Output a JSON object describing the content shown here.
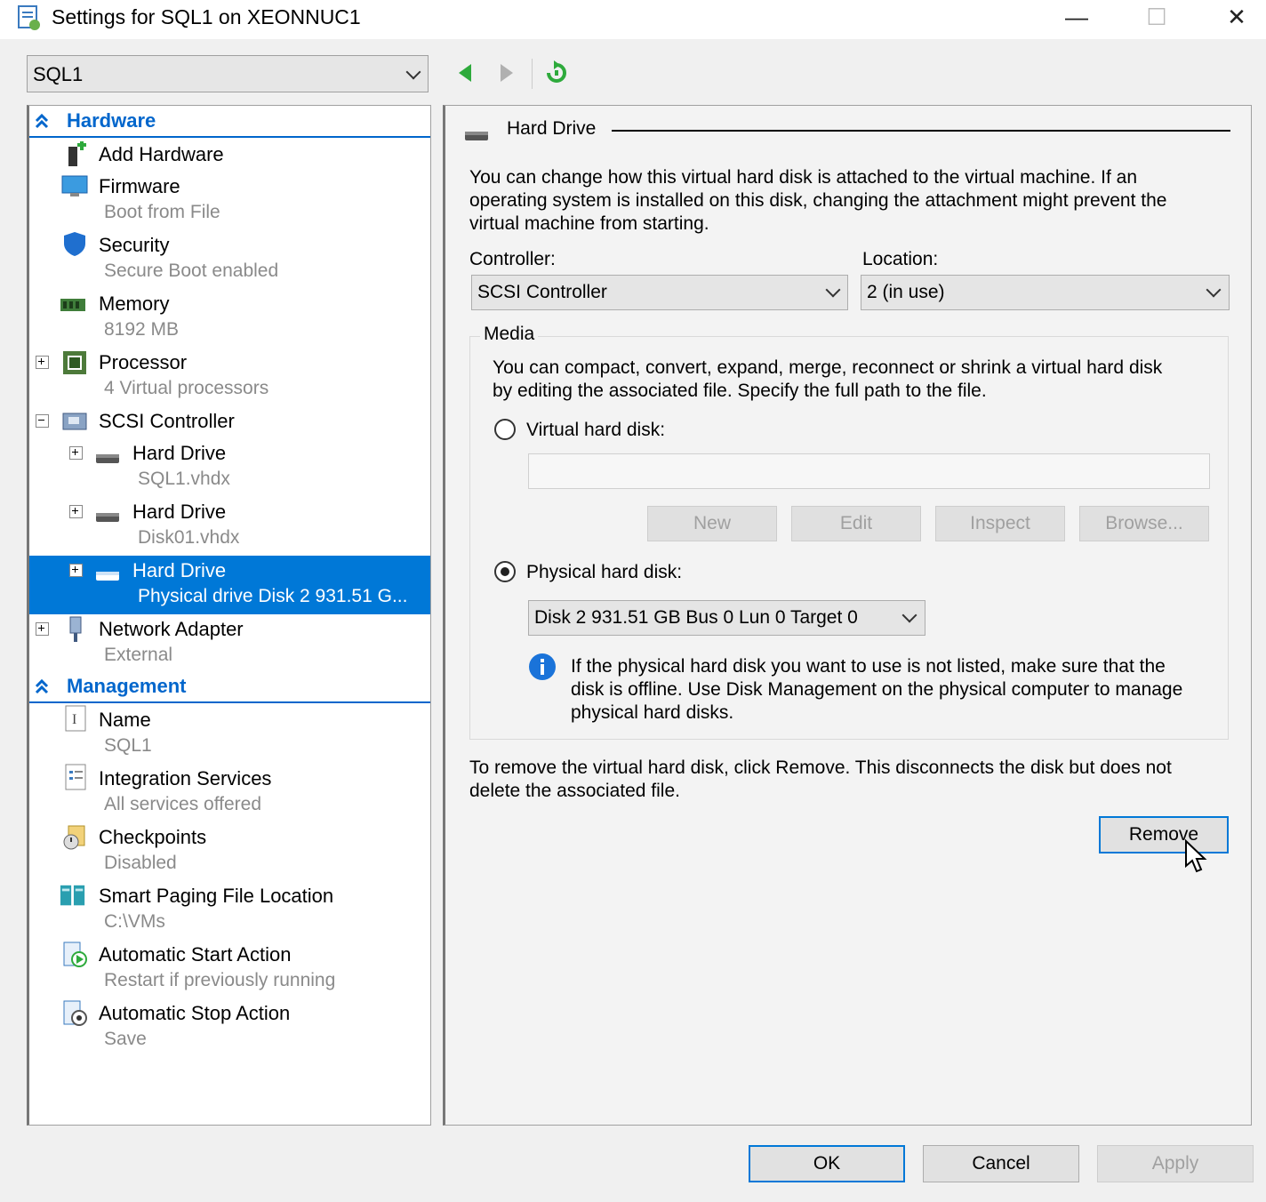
{
  "window": {
    "title": "Settings for SQL1 on XEONNUC1",
    "minimize": "—",
    "maximize": "☐",
    "close": "✕"
  },
  "vm_selector": {
    "value": "SQL1"
  },
  "tree": {
    "hardware_header": "Hardware",
    "management_header": "Management",
    "items": [
      {
        "label": "Add Hardware",
        "sub": ""
      },
      {
        "label": "Firmware",
        "sub": "Boot from File"
      },
      {
        "label": "Security",
        "sub": "Secure Boot enabled"
      },
      {
        "label": "Memory",
        "sub": "8192 MB"
      },
      {
        "label": "Processor",
        "sub": "4 Virtual processors"
      },
      {
        "label": "SCSI Controller",
        "sub": ""
      },
      {
        "label": "Hard Drive",
        "sub": "SQL1.vhdx"
      },
      {
        "label": "Hard Drive",
        "sub": "Disk01.vhdx"
      },
      {
        "label": "Hard Drive",
        "sub": "Physical drive Disk 2 931.51 G..."
      },
      {
        "label": "Network Adapter",
        "sub": "External"
      }
    ],
    "mgmt_items": [
      {
        "label": "Name",
        "sub": "SQL1"
      },
      {
        "label": "Integration Services",
        "sub": "All services offered"
      },
      {
        "label": "Checkpoints",
        "sub": "Disabled"
      },
      {
        "label": "Smart Paging File Location",
        "sub": "C:\\VMs"
      },
      {
        "label": "Automatic Start Action",
        "sub": "Restart if previously running"
      },
      {
        "label": "Automatic Stop Action",
        "sub": "Save"
      }
    ]
  },
  "panel": {
    "heading": "Hard Drive",
    "intro_line1": "You can change how this virtual hard disk is attached to the virtual machine. If an",
    "intro_line2": "operating system is installed on this disk, changing the attachment might prevent the",
    "intro_line3": "virtual machine from starting.",
    "controller_label": "Controller:",
    "controller_value": "SCSI Controller",
    "location_label": "Location:",
    "location_value": "2 (in use)",
    "media_label": "Media",
    "media_line1": "You can compact, convert, expand, merge, reconnect or shrink a virtual hard disk",
    "media_line2": "by editing the associated file. Specify the full path to the file.",
    "vhd_label": "Virtual hard disk:",
    "vhd_path": "",
    "btn_new": "New",
    "btn_edit": "Edit",
    "btn_inspect": "Inspect",
    "btn_browse": "Browse...",
    "phys_label": "Physical hard disk:",
    "phys_value": "Disk 2 931.51 GB Bus 0 Lun 0 Target 0",
    "info_line1": "If the physical hard disk you want to use is not listed, make sure that the",
    "info_line2": "disk is offline. Use Disk Management on the physical computer to manage",
    "info_line3": "physical hard disks.",
    "remove_line1": "To remove the virtual hard disk, click Remove. This disconnects the disk but does not",
    "remove_line2": "delete the associated file.",
    "btn_remove": "Remove"
  },
  "footer": {
    "ok": "OK",
    "cancel": "Cancel",
    "apply": "Apply"
  },
  "colors": {
    "accent": "#0078d7",
    "header_blue": "#0066cc",
    "disabled_text": "#a0a0a0"
  }
}
